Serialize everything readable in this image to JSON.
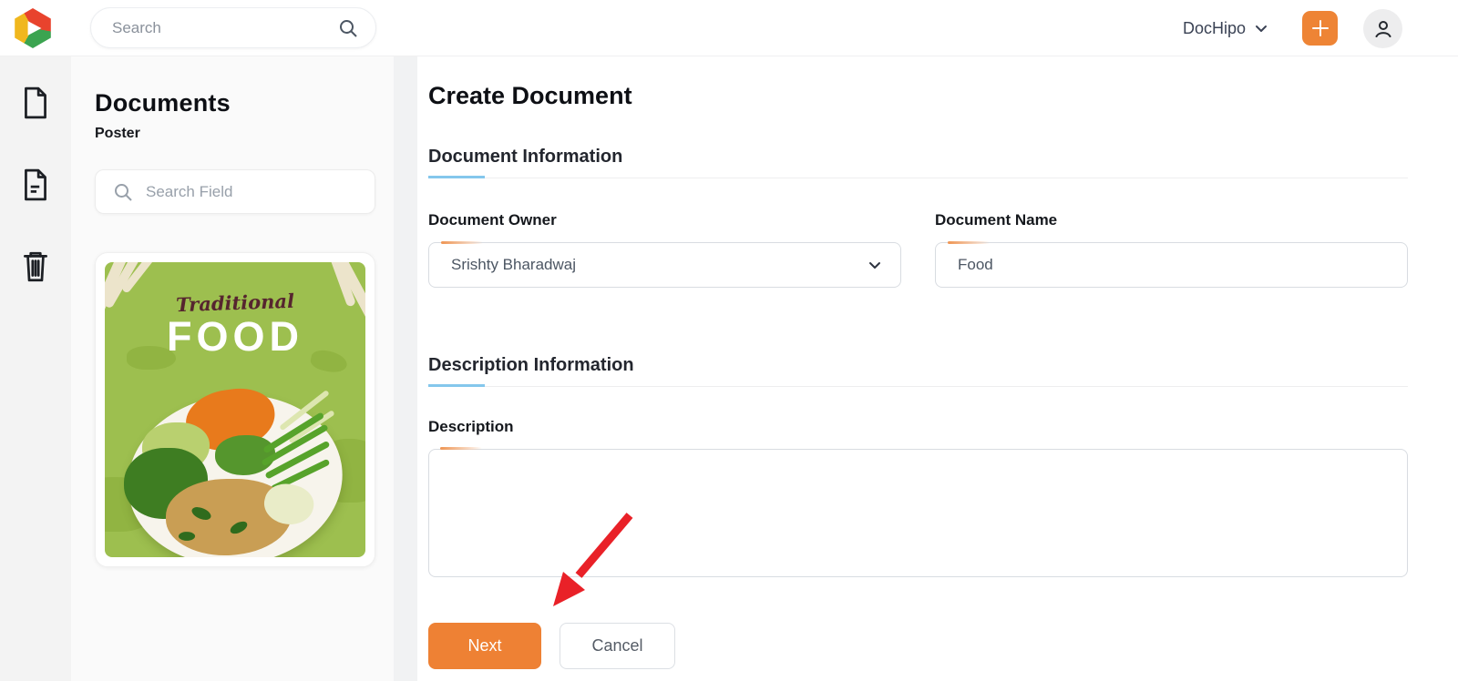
{
  "colors": {
    "accent_orange": "#ee8134",
    "underline_blue": "#84c7ec",
    "arrow_red": "#e92128",
    "poster_green": "#9dbf4f",
    "rail_bg": "#f3f3f3"
  },
  "header": {
    "search_placeholder": "Search",
    "workspace_label": "DocHipo",
    "icons": [
      "app-logo",
      "search-icon",
      "chevron-down-icon",
      "plus-icon",
      "person-icon"
    ]
  },
  "rail": {
    "icons": [
      "document-icon",
      "template-icon",
      "trash-icon"
    ]
  },
  "sidebar": {
    "title": "Documents",
    "subtitle": "Poster",
    "search_placeholder": "Search Field",
    "poster": {
      "script_text": "Traditional",
      "title_text": "FOOD"
    }
  },
  "main": {
    "title": "Create Document",
    "sections": [
      {
        "title": "Document Information"
      },
      {
        "title": "Description Information"
      }
    ],
    "fields": {
      "owner_label": "Document Owner",
      "owner_value": "Srishty Bharadwaj",
      "name_label": "Document Name",
      "name_value": "Food",
      "description_label": "Description",
      "description_value": ""
    },
    "buttons": {
      "next": "Next",
      "cancel": "Cancel"
    }
  }
}
